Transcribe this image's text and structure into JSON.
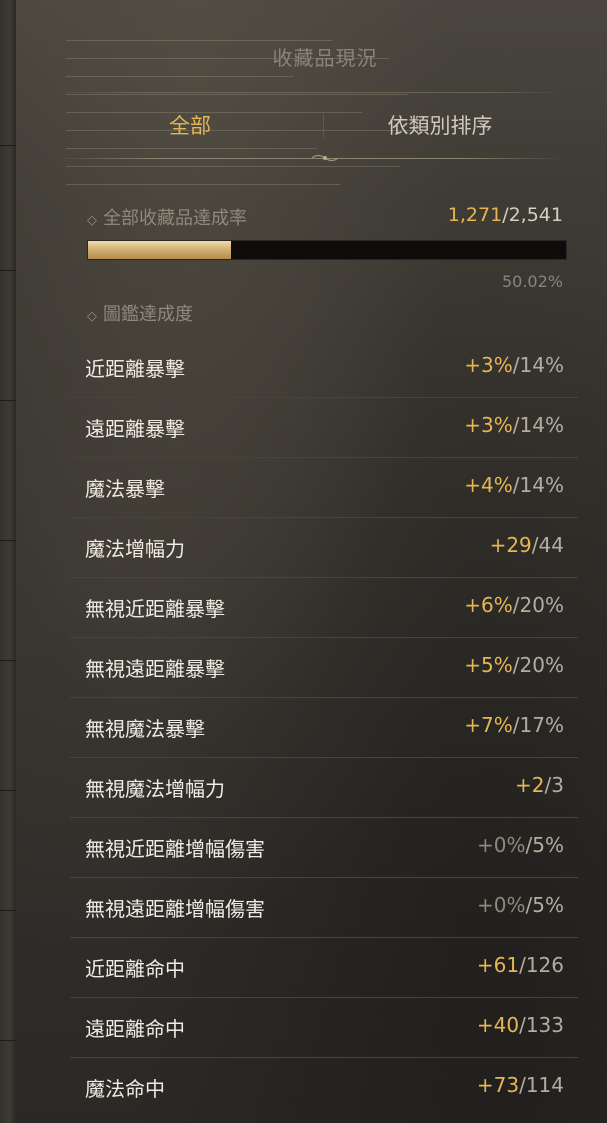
{
  "title": "收藏品現況",
  "tabs": [
    {
      "label": "全部",
      "active": true
    },
    {
      "label": "依類別排序",
      "active": false
    }
  ],
  "overall": {
    "label": "全部收藏品達成率",
    "current": "1,271",
    "total": "2,541",
    "percent_text": "50.02%",
    "progress_fraction": 0.5002
  },
  "codex_label": "圖鑑達成度",
  "stats": [
    {
      "label": "近距離暴擊",
      "bonus": "+3%",
      "max": "14%"
    },
    {
      "label": "遠距離暴擊",
      "bonus": "+3%",
      "max": "14%"
    },
    {
      "label": "魔法暴擊",
      "bonus": "+4%",
      "max": "14%"
    },
    {
      "label": "魔法增幅力",
      "bonus": "+29",
      "max": "44"
    },
    {
      "label": "無視近距離暴擊",
      "bonus": "+6%",
      "max": "20%"
    },
    {
      "label": "無視遠距離暴擊",
      "bonus": "+5%",
      "max": "20%"
    },
    {
      "label": "無視魔法暴擊",
      "bonus": "+7%",
      "max": "17%"
    },
    {
      "label": "無視魔法增幅力",
      "bonus": "+2",
      "max": "3"
    },
    {
      "label": "無視近距離增幅傷害",
      "bonus": "+0%",
      "max": "5%"
    },
    {
      "label": "無視遠距離增幅傷害",
      "bonus": "+0%",
      "max": "5%"
    },
    {
      "label": "近距離命中",
      "bonus": "+61",
      "max": "126"
    },
    {
      "label": "遠距離命中",
      "bonus": "+40",
      "max": "133"
    },
    {
      "label": "魔法命中",
      "bonus": "+73",
      "max": "114"
    }
  ],
  "colors": {
    "accent_gold": "#e6b655",
    "text_light": "#f0ece3",
    "text_muted": "#8f897c"
  }
}
